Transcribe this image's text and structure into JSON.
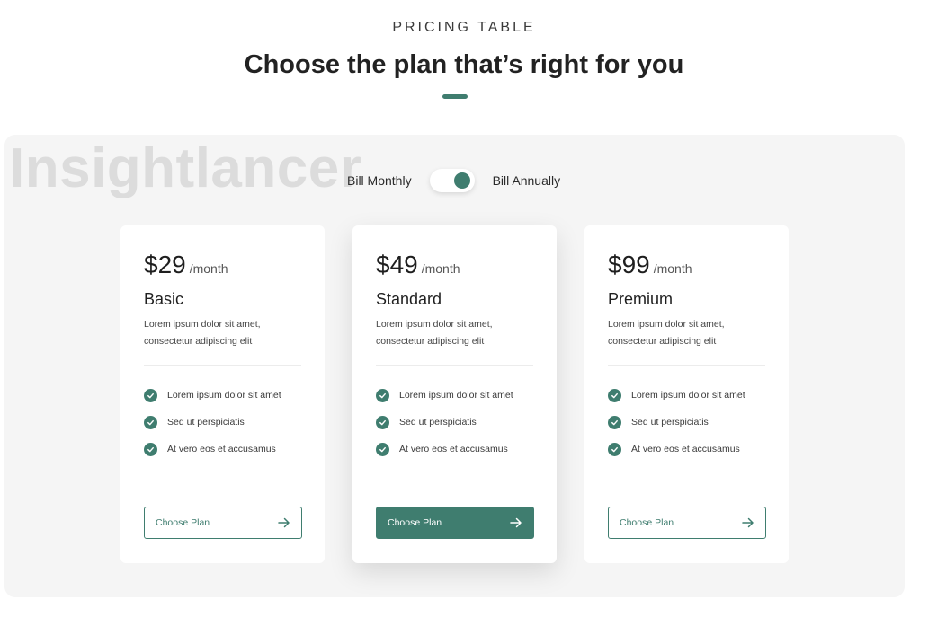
{
  "header": {
    "eyebrow": "PRICING TABLE",
    "title": "Choose the plan that’s right for you"
  },
  "watermark": "Insightlancer",
  "billing": {
    "monthly_label": "Bill Monthly",
    "annual_label": "Bill Annually",
    "selected": "annually"
  },
  "colors": {
    "accent": "#3f7d6f",
    "panel": "#f5f5f5"
  },
  "plans": [
    {
      "price": "$29",
      "period": "/month",
      "name": "Basic",
      "description": "Lorem ipsum dolor sit amet, consectetur adipiscing elit",
      "features": [
        "Lorem ipsum dolor sit amet",
        "Sed ut perspiciatis",
        "At vero eos et accusamus"
      ],
      "button_label": "Choose Plan",
      "featured": false
    },
    {
      "price": "$49",
      "period": "/month",
      "name": "Standard",
      "description": "Lorem ipsum dolor sit amet, consectetur adipiscing elit",
      "features": [
        "Lorem ipsum dolor sit amet",
        "Sed ut perspiciatis",
        "At vero eos et accusamus"
      ],
      "button_label": "Choose Plan",
      "featured": true
    },
    {
      "price": "$99",
      "period": "/month",
      "name": "Premium",
      "description": "Lorem ipsum dolor sit amet, consectetur adipiscing elit",
      "features": [
        "Lorem ipsum dolor sit amet",
        "Sed ut perspiciatis",
        "At vero eos et accusamus"
      ],
      "button_label": "Choose Plan",
      "featured": false
    }
  ],
  "icons": {
    "feature_icon": "check-circle-icon",
    "button_icon": "arrow-right-icon"
  }
}
